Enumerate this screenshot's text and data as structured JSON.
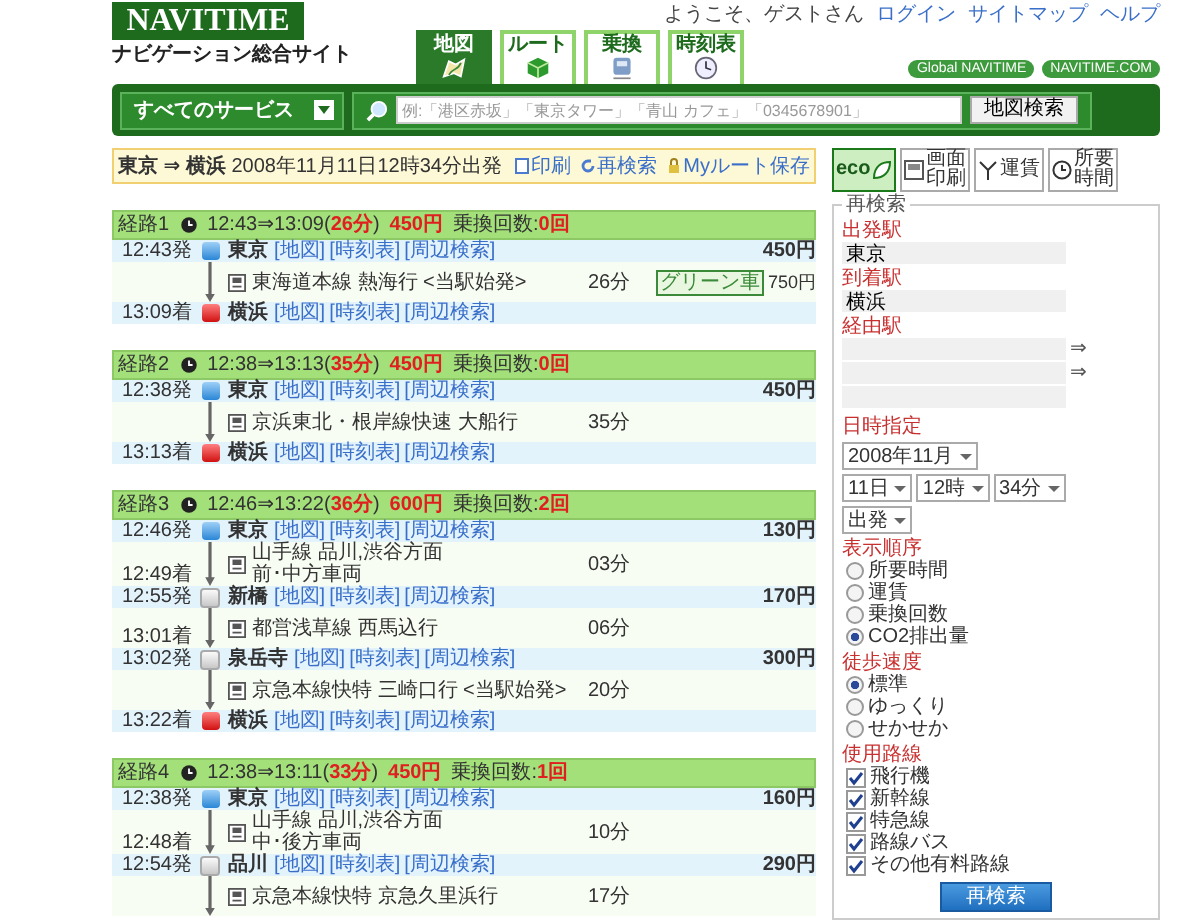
{
  "header": {
    "logo": "NAVITIME",
    "subtitle": "ナビゲーション総合サイト",
    "welcome": "ようこそ、ゲストさん",
    "links": [
      "ログイン",
      "サイトマップ",
      "ヘルプ"
    ],
    "tabs": [
      {
        "label": "地図",
        "selected": true
      },
      {
        "label": "ルート",
        "selected": false
      },
      {
        "label": "乗換",
        "selected": false
      },
      {
        "label": "時刻表",
        "selected": false
      }
    ],
    "pills": [
      "Global NAVITIME",
      "NAVITIME.COM"
    ]
  },
  "searchbar": {
    "services": "すべてのサービス",
    "placeholder": "例:「港区赤坂」「東京タワー」「青山 カフェ」「0345678901」",
    "button": "地図検索"
  },
  "summary": {
    "text": "**東京 ⇒ 横浜** 2008年11月11日12時34分出発",
    "actions": [
      "印刷",
      "再検索",
      "Myルート保存"
    ]
  },
  "routes": [
    {
      "label": "経路1",
      "time": "12:43⇒13:09(**26分**)",
      "fare": "450円",
      "transfers": "乗換回数:**0回**",
      "steps": [
        {
          "kind": "station",
          "time": "12:43発",
          "name": "東京",
          "links": [
            "[地図]",
            "[時刻表]",
            "[周辺検索]"
          ],
          "fare": "450円"
        },
        {
          "kind": "segment",
          "line": "東海道本線 熱海行 <当駅始発>",
          "duration": "26分",
          "badge": "グリーン車",
          "fare": "750円"
        },
        {
          "kind": "station",
          "time": "13:09着",
          "name": "横浜",
          "links": [
            "[地図]",
            "[時刻表]",
            "[周辺検索]"
          ]
        }
      ]
    },
    {
      "label": "経路2",
      "time": "12:38⇒13:13(**35分**)",
      "fare": "450円",
      "transfers": "乗換回数:**0回**",
      "steps": [
        {
          "kind": "station",
          "time": "12:38発",
          "name": "東京",
          "links": [
            "[地図]",
            "[時刻表]",
            "[周辺検索]"
          ],
          "fare": "450円"
        },
        {
          "kind": "segment",
          "line": "京浜東北・根岸線快速 大船行",
          "duration": "35分"
        },
        {
          "kind": "station",
          "time": "13:13着",
          "name": "横浜",
          "links": [
            "[地図]",
            "[時刻表]",
            "[周辺検索]"
          ]
        }
      ]
    },
    {
      "label": "経路3",
      "time": "12:46⇒13:22(**36分**)",
      "fare": "600円",
      "transfers": "乗換回数:**2回**",
      "steps": [
        {
          "kind": "station",
          "time": "12:46発",
          "name": "東京",
          "links": [
            "[地図]",
            "[時刻表]",
            "[周辺検索]"
          ],
          "fare": "130円"
        },
        {
          "kind": "segment",
          "line": "山手線 品川,渋谷方面",
          "cars": "前･中方車両",
          "duration": "03分",
          "arrive": "12:49着"
        },
        {
          "kind": "station",
          "time": "12:55発",
          "name": "新橋",
          "links": [
            "[地図]",
            "[時刻表]",
            "[周辺検索]"
          ],
          "fare": "170円"
        },
        {
          "kind": "segment",
          "line": "都営浅草線 西馬込行",
          "duration": "06分",
          "arrive": "13:01着"
        },
        {
          "kind": "station",
          "time": "13:02発",
          "name": "泉岳寺",
          "links": [
            "[地図]",
            "[時刻表]",
            "[周辺検索]"
          ],
          "fare": "300円"
        },
        {
          "kind": "segment",
          "line": "京急本線快特 三崎口行 <当駅始発>",
          "duration": "20分"
        },
        {
          "kind": "station",
          "time": "13:22着",
          "name": "横浜",
          "links": [
            "[地図]",
            "[時刻表]",
            "[周辺検索]"
          ]
        }
      ]
    },
    {
      "label": "経路4",
      "time": "12:38⇒13:11(**33分**)",
      "fare": "450円",
      "transfers": "乗換回数:**1回**",
      "steps": [
        {
          "kind": "station",
          "time": "12:38発",
          "name": "東京",
          "links": [
            "[地図]",
            "[時刻表]",
            "[周辺検索]"
          ],
          "fare": "160円"
        },
        {
          "kind": "segment",
          "line": "山手線 品川,渋谷方面",
          "cars": "中･後方車両",
          "duration": "10分",
          "arrive": "12:48着"
        },
        {
          "kind": "station",
          "time": "12:54発",
          "name": "品川",
          "links": [
            "[地図]",
            "[時刻表]",
            "[周辺検索]"
          ],
          "fare": "290円"
        },
        {
          "kind": "segment",
          "line": "京急本線快特 京急久里浜行",
          "duration": "17分"
        }
      ]
    }
  ],
  "tools": [
    {
      "kind": "eco",
      "label": "eco"
    },
    {
      "kind": "print",
      "label": "画面印刷"
    },
    {
      "kind": "fare",
      "label": "運賃"
    },
    {
      "kind": "time",
      "label": "所要時間"
    }
  ],
  "research": {
    "legend": "再検索",
    "from": {
      "label": "出発駅",
      "value": "東京"
    },
    "to": {
      "label": "到着駅",
      "value": "横浜"
    },
    "via": {
      "label": "経由駅",
      "arrows": [
        "⇒",
        "⇒"
      ]
    },
    "datetime": {
      "label": "日時指定",
      "month": "2008年11月",
      "day": "11日",
      "hour": "12時",
      "minute": "34分",
      "type": "出発"
    },
    "groups": [
      {
        "label": "表示順序",
        "kind": "radio",
        "options": [
          {
            "label": "所要時間",
            "selected": false
          },
          {
            "label": "運賃",
            "selected": false
          },
          {
            "label": "乗換回数",
            "selected": false
          },
          {
            "label": "CO2排出量",
            "selected": true
          }
        ]
      },
      {
        "label": "徒歩速度",
        "kind": "radio",
        "options": [
          {
            "label": "標準",
            "selected": true
          },
          {
            "label": "ゆっくり",
            "selected": false
          },
          {
            "label": "せかせか",
            "selected": false
          }
        ]
      },
      {
        "label": "使用路線",
        "kind": "check",
        "options": [
          {
            "label": "飛行機",
            "checked": true
          },
          {
            "label": "新幹線",
            "checked": true
          },
          {
            "label": "特急線",
            "checked": true
          },
          {
            "label": "路線バス",
            "checked": true
          },
          {
            "label": "その他有料路線",
            "checked": true
          }
        ]
      }
    ],
    "button": "再検索"
  }
}
